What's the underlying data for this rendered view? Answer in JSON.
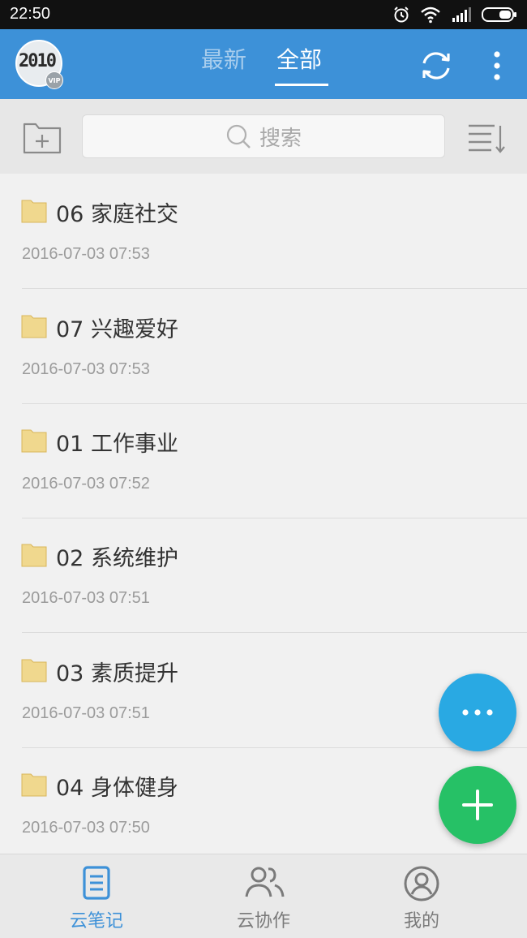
{
  "status_bar": {
    "time": "22:50",
    "icons": [
      "alarm-icon",
      "wifi-icon",
      "signal-icon",
      "battery-icon"
    ]
  },
  "header": {
    "avatar": {
      "text": "2010",
      "badge": "VIP"
    },
    "tabs": [
      {
        "label": "最新",
        "active": false
      },
      {
        "label": "全部",
        "active": true
      }
    ],
    "actions": [
      "sync-icon",
      "more-vertical-icon"
    ]
  },
  "toolbar": {
    "search_placeholder": "搜索",
    "icons": [
      "new-folder-icon",
      "search-icon",
      "sort-icon"
    ]
  },
  "folders": [
    {
      "name": "06 家庭社交",
      "date": "2016-07-03 07:53"
    },
    {
      "name": "07 兴趣爱好",
      "date": "2016-07-03 07:53"
    },
    {
      "name": "01 工作事业",
      "date": "2016-07-03 07:52"
    },
    {
      "name": "02 系统维护",
      "date": "2016-07-03 07:51"
    },
    {
      "name": "03 素质提升",
      "date": "2016-07-03 07:51"
    },
    {
      "name": "04 身体健身",
      "date": "2016-07-03 07:50"
    }
  ],
  "fabs": [
    "more-horizontal-icon",
    "plus-icon"
  ],
  "bottom_nav": [
    {
      "label": "云笔记",
      "icon": "notes-icon",
      "active": true
    },
    {
      "label": "云协作",
      "icon": "people-icon",
      "active": false
    },
    {
      "label": "我的",
      "icon": "user-circle-icon",
      "active": false
    }
  ],
  "colors": {
    "header_bg": "#3d91d8",
    "active_nav": "#3d91d8",
    "inactive_nav": "#7a7a7a",
    "folder": "#f0d88e",
    "fab_more": "#29a9e3",
    "fab_add": "#26c166"
  }
}
